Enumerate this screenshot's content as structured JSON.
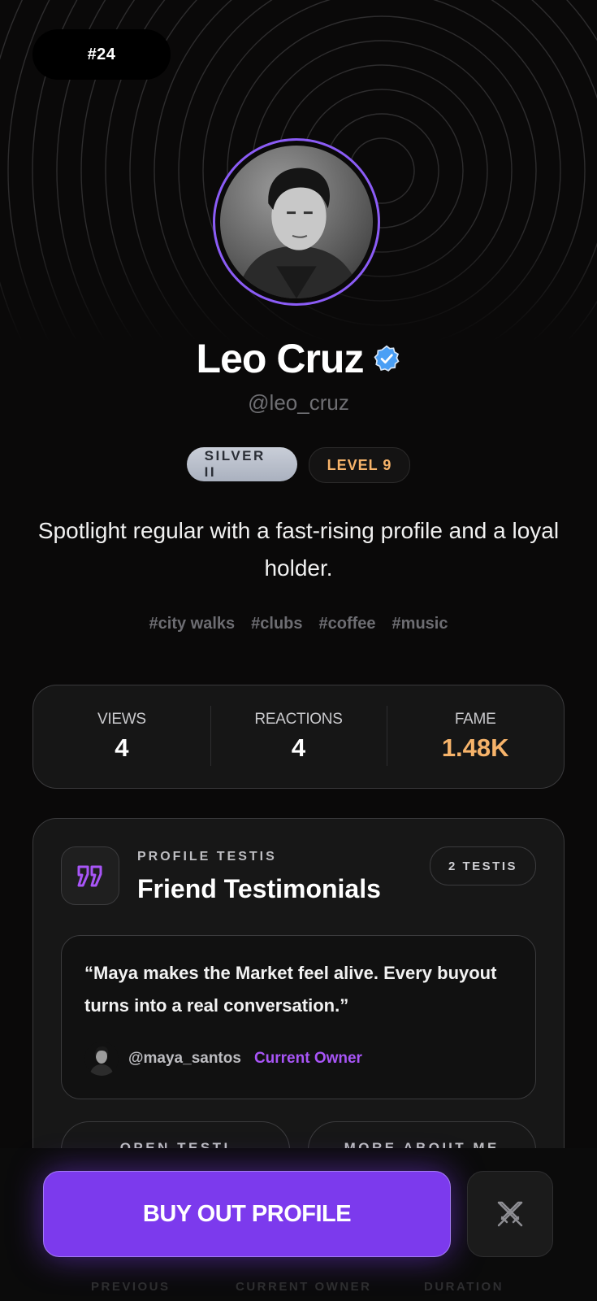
{
  "rank": "#24",
  "profile": {
    "name": "Leo Cruz",
    "handle": "@leo_cruz",
    "tier_badge": "SILVER II",
    "level_badge": "LEVEL 9",
    "bio": "Spotlight regular with a fast-rising profile and a loyal holder.",
    "tags": [
      "#city walks",
      "#clubs",
      "#coffee",
      "#music"
    ]
  },
  "stats": [
    {
      "label": "VIEWS",
      "value": "4"
    },
    {
      "label": "REACTIONS",
      "value": "4"
    },
    {
      "label": "FAME",
      "value": "1.48K"
    }
  ],
  "testimonials_card": {
    "eyebrow": "PROFILE TESTIS",
    "title": "Friend Testimonials",
    "count_badge": "2 TESTIS",
    "quote": "“Maya makes the Market feel alive. Every buyout turns into a real conversation.”",
    "author_handle": "@maya_santos",
    "author_role": "Current Owner",
    "actions": [
      "OPEN TESTI",
      "MORE ABOUT ME"
    ]
  },
  "cta": {
    "buyout_label": "BUY OUT PROFILE",
    "battle_icon": "crossed-swords-icon"
  },
  "footer_labels": [
    "PREVIOUS",
    "CURRENT OWNER",
    "DURATION"
  ],
  "colors": {
    "accent": "#7c3aed",
    "accent_text": "#a855f7",
    "gold": "#f6b36a",
    "background": "#0a0909",
    "verified": "#4a9ff5"
  }
}
